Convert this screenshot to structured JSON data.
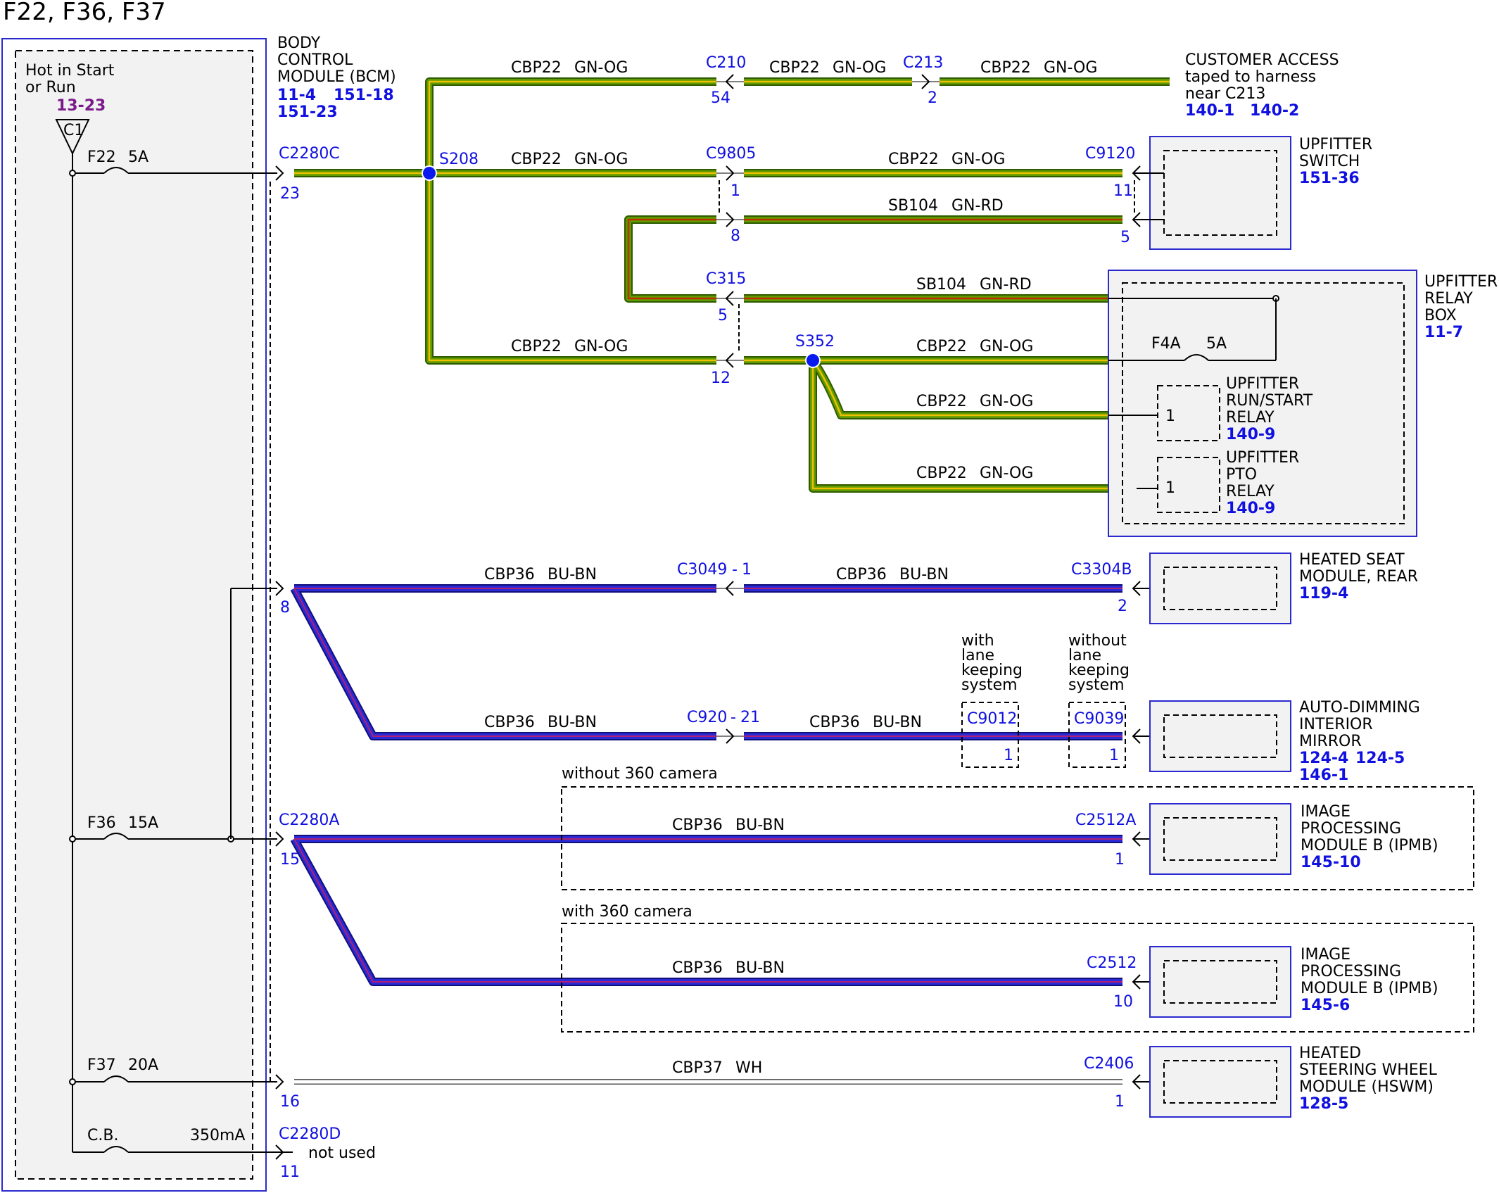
{
  "title": "F22, F36, F37",
  "bcm": {
    "name": [
      "BODY",
      "CONTROL",
      "MODULE (BCM)"
    ],
    "refs": [
      "11-4",
      "151-18",
      "151-23"
    ],
    "hot_label": [
      "Hot in Start",
      "or Run"
    ],
    "hot_ref": "13-23",
    "c1": "C1",
    "fuses": {
      "f22": "F22",
      "f22_rating": "5A",
      "f36": "F36",
      "f36_rating": "15A",
      "f37": "F37",
      "f37_rating": "20A",
      "cb": "C.B.",
      "cb_rating": "350mA"
    },
    "connectors": {
      "c2280c": "C2280C",
      "c2280c_pin": "23",
      "pin8": "8",
      "c2280a": "C2280A",
      "c2280a_pin": "15",
      "pin16": "16",
      "c2280d": "C2280D",
      "c2280d_pin": "11",
      "not_used": "not used"
    }
  },
  "wires": {
    "cbp22_name": "CBP22",
    "cbp22_color": "GN-OG",
    "sb104_name": "SB104",
    "sb104_color": "GN-RD",
    "cbp36_name": "CBP36",
    "cbp36_color": "BU-BN",
    "cbp37_name": "CBP37",
    "cbp37_color": "WH"
  },
  "splices": {
    "s208": "S208",
    "s352": "S352"
  },
  "inline": {
    "c210": "C210",
    "c210_pin": "54",
    "c213": "C213",
    "c213_pin": "2",
    "c9805": "C9805",
    "c9805_pin_a": "1",
    "c9805_pin_b": "8",
    "c315": "C315",
    "c315_pin_a": "5",
    "c315_pin_b": "12",
    "c3049": "C3049",
    "c3049_pin": "1",
    "c920": "C920",
    "c920_pin": "21",
    "c9012": "C9012",
    "c9012_pin": "1",
    "c9039": "C9039",
    "c9039_pin": "1",
    "with_lks": [
      "with",
      "lane",
      "keeping",
      "system"
    ],
    "without_lks": [
      "without",
      "lane",
      "keeping",
      "system"
    ]
  },
  "components": {
    "customer_access": {
      "lines": [
        "CUSTOMER ACCESS",
        "taped to harness",
        "near C213"
      ],
      "refs": [
        "140-1",
        "140-2"
      ]
    },
    "upfitter_switch": {
      "lines": [
        "UPFITTER",
        "SWITCH"
      ],
      "ref": "151-36",
      "conn": "C9120",
      "pin_a": "11",
      "pin_b": "5"
    },
    "relay_box": {
      "lines": [
        "UPFITTER",
        "RELAY",
        "BOX"
      ],
      "ref": "11-7",
      "fuse": "F4A",
      "fuse_rating": "5A",
      "run_relay": [
        "UPFITTER",
        "RUN/START",
        "RELAY"
      ],
      "run_ref": "140-9",
      "run_pin": "1",
      "pto_relay": [
        "UPFITTER",
        "PTO",
        "RELAY"
      ],
      "pto_ref": "140-9",
      "pto_pin": "1"
    },
    "heated_seat": {
      "lines": [
        "HEATED SEAT",
        "MODULE, REAR"
      ],
      "ref": "119-4",
      "conn": "C3304B",
      "pin": "2"
    },
    "mirror": {
      "lines": [
        "AUTO-DIMMING",
        "INTERIOR",
        "MIRROR"
      ],
      "refs": [
        "124-4",
        "124-5",
        "146-1"
      ]
    },
    "ipmb_a": {
      "lines": [
        "IMAGE",
        "PROCESSING",
        "MODULE B (IPMB)"
      ],
      "ref": "145-10",
      "conn": "C2512A",
      "pin": "1",
      "option": "without 360 camera"
    },
    "ipmb_b": {
      "lines": [
        "IMAGE",
        "PROCESSING",
        "MODULE B (IPMB)"
      ],
      "ref": "145-6",
      "conn": "C2512",
      "pin": "10",
      "option": "with 360 camera"
    },
    "hswm": {
      "lines": [
        "HEATED",
        "STEERING WHEEL",
        "MODULE (HSWM)"
      ],
      "ref": "128-5",
      "conn": "C2406",
      "pin": "1"
    }
  },
  "colors": {
    "green": "#4a7a00",
    "green_stripe": "#f0c000",
    "red_stripe": "#c03000",
    "blue": "#1a1aaa",
    "blue_stripe": "#c02060",
    "label_blue": "#1010e0",
    "ref_purple": "#7a1a8a"
  }
}
